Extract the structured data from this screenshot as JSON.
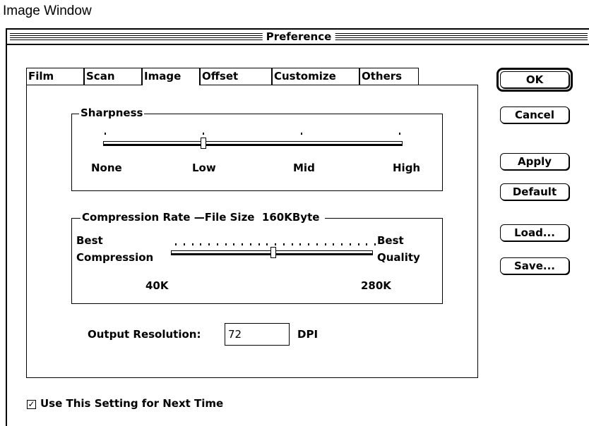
{
  "caption": "Image Window",
  "window": {
    "title": "Preference"
  },
  "tabs": [
    {
      "label": "Film",
      "active": false
    },
    {
      "label": "Scan",
      "active": false
    },
    {
      "label": "Image",
      "active": true
    },
    {
      "label": "Offset",
      "active": false
    },
    {
      "label": "Customize",
      "active": false
    },
    {
      "label": "Others",
      "active": false
    }
  ],
  "sharpness": {
    "title": "Sharpness",
    "levels": [
      "None",
      "Low",
      "Mid",
      "High"
    ],
    "selected": "Low"
  },
  "compression": {
    "title": "Compression Rate —File Size",
    "file_size": "160KByte",
    "left_label_1": "Best",
    "left_label_2": "Compression",
    "right_label_1": "Best",
    "right_label_2": "Quality",
    "min_label": "40K",
    "max_label": "280K",
    "position_fraction": 0.51
  },
  "output_resolution": {
    "label": "Output Resolution:",
    "value": "72",
    "unit": "DPI"
  },
  "buttons": {
    "ok": "OK",
    "cancel": "Cancel",
    "apply": "Apply",
    "default": "Default",
    "load": "Load...",
    "save": "Save..."
  },
  "checkbox": {
    "label": "Use This Setting for Next Time",
    "checked": true,
    "mark": "✓"
  }
}
